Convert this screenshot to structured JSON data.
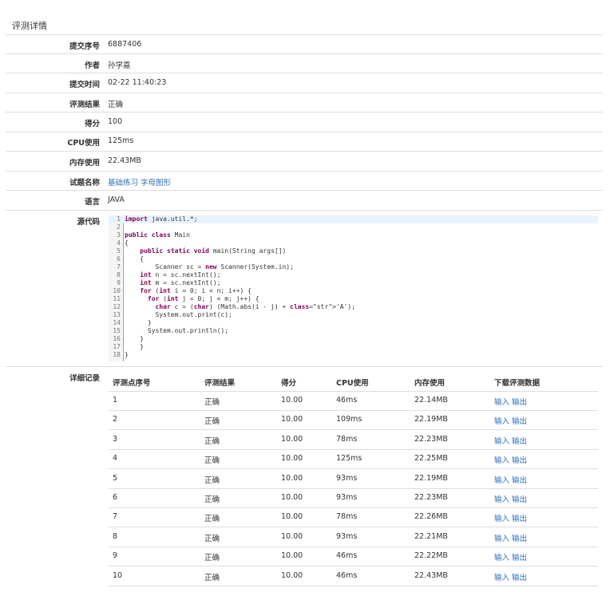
{
  "page": {
    "title": "评测详情"
  },
  "fields": {
    "submit_id": {
      "label": "提交序号",
      "value": "6887406"
    },
    "author": {
      "label": "作者",
      "value": "孙学嘉"
    },
    "submit_time": {
      "label": "提交时间",
      "value": "02-22 11:40:23"
    },
    "result": {
      "label": "评测结果",
      "value": "正确"
    },
    "score": {
      "label": "得分",
      "value": "100"
    },
    "cpu": {
      "label": "CPU使用",
      "value": "125ms"
    },
    "memory": {
      "label": "内存使用",
      "value": "22.43MB"
    },
    "problem": {
      "label": "试题名称",
      "category": "基础练习",
      "name": "字母图形"
    },
    "language": {
      "label": "语言",
      "value": "JAVA"
    },
    "source": {
      "label": "源代码"
    },
    "details": {
      "label": "详细记录"
    }
  },
  "code_lines": [
    "import java.util.*;",
    "",
    "public class Main",
    "{",
    "    public static void main(String args[])",
    "    {",
    "        Scanner sc = new Scanner(System.in);",
    "    int n = sc.nextInt();",
    "    int m = sc.nextInt();",
    "    for (int i = 0; i < n; i++) {",
    "      for (int j = 0; j < m; j++) {",
    "        char c = (char) (Math.abs(i - j) + 'A');",
    "        System.out.print(c);",
    "      }",
    "      System.out.println();",
    "    }",
    "    }",
    "}"
  ],
  "table": {
    "headers": [
      "评测点序号",
      "评测结果",
      "得分",
      "CPU使用",
      "内存使用",
      "下载评测数据"
    ],
    "input_label": "输入",
    "output_label": "输出",
    "rows": [
      [
        "1",
        "正确",
        "10.00",
        "46ms",
        "22.14MB"
      ],
      [
        "2",
        "正确",
        "10.00",
        "109ms",
        "22.19MB"
      ],
      [
        "3",
        "正确",
        "10.00",
        "78ms",
        "22.23MB"
      ],
      [
        "4",
        "正确",
        "10.00",
        "125ms",
        "22.25MB"
      ],
      [
        "5",
        "正确",
        "10.00",
        "93ms",
        "22.19MB"
      ],
      [
        "6",
        "正确",
        "10.00",
        "93ms",
        "22.23MB"
      ],
      [
        "7",
        "正确",
        "10.00",
        "78ms",
        "22.26MB"
      ],
      [
        "8",
        "正确",
        "10.00",
        "93ms",
        "22.21MB"
      ],
      [
        "9",
        "正确",
        "10.00",
        "46ms",
        "22.22MB"
      ],
      [
        "10",
        "正确",
        "10.00",
        "46ms",
        "22.43MB"
      ]
    ]
  },
  "colors": {
    "link": "#2a6ebb",
    "border": "#dddddd",
    "highlight": "#e8f2fe"
  }
}
